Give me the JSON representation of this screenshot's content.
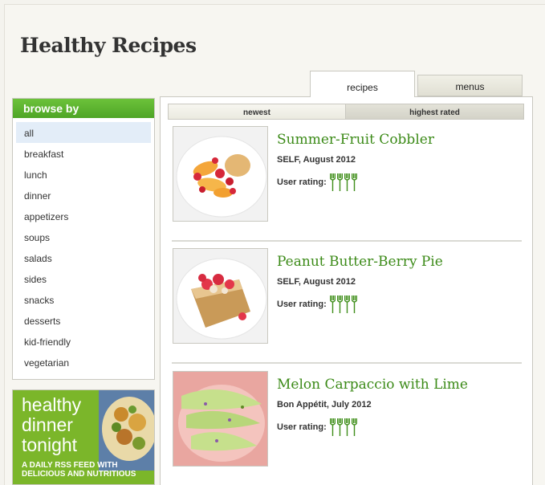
{
  "page": {
    "title": "Healthy Recipes"
  },
  "tabs": {
    "recipes": "recipes",
    "menus": "menus"
  },
  "subtabs": {
    "newest": "newest",
    "highest_rated": "highest rated"
  },
  "sidebar": {
    "header": "browse by",
    "items": [
      {
        "label": "all",
        "active": true
      },
      {
        "label": "breakfast"
      },
      {
        "label": "lunch"
      },
      {
        "label": "dinner"
      },
      {
        "label": "appetizers"
      },
      {
        "label": "soups"
      },
      {
        "label": "salads"
      },
      {
        "label": "sides"
      },
      {
        "label": "snacks"
      },
      {
        "label": "desserts"
      },
      {
        "label": "kid-friendly"
      },
      {
        "label": "vegetarian"
      }
    ]
  },
  "ad": {
    "line1": "healthy",
    "line2": "dinner",
    "line3": "tonight",
    "subline1": "A DAILY RSS FEED WITH",
    "subline2": "DELICIOUS AND NUTRITIOUS"
  },
  "recipes": [
    {
      "title": "Summer-Fruit Cobbler",
      "source": "SELF, August 2012",
      "rating_label": "User rating:",
      "rating": 4,
      "rating_max": 4,
      "image_icon": "cobbler-photo-icon"
    },
    {
      "title": "Peanut Butter-Berry Pie",
      "source": "SELF, August 2012",
      "rating_label": "User rating:",
      "rating": 4,
      "rating_max": 4,
      "image_icon": "pie-photo-icon"
    },
    {
      "title": "Melon Carpaccio with Lime",
      "source": "Bon Appétit, July 2012",
      "rating_label": "User rating:",
      "rating": 4,
      "rating_max": 4,
      "image_icon": "melon-photo-icon"
    }
  ],
  "colors": {
    "accent_green": "#4ea526",
    "title_green": "#3b8a17",
    "fork_green": "#3f8e1a"
  }
}
